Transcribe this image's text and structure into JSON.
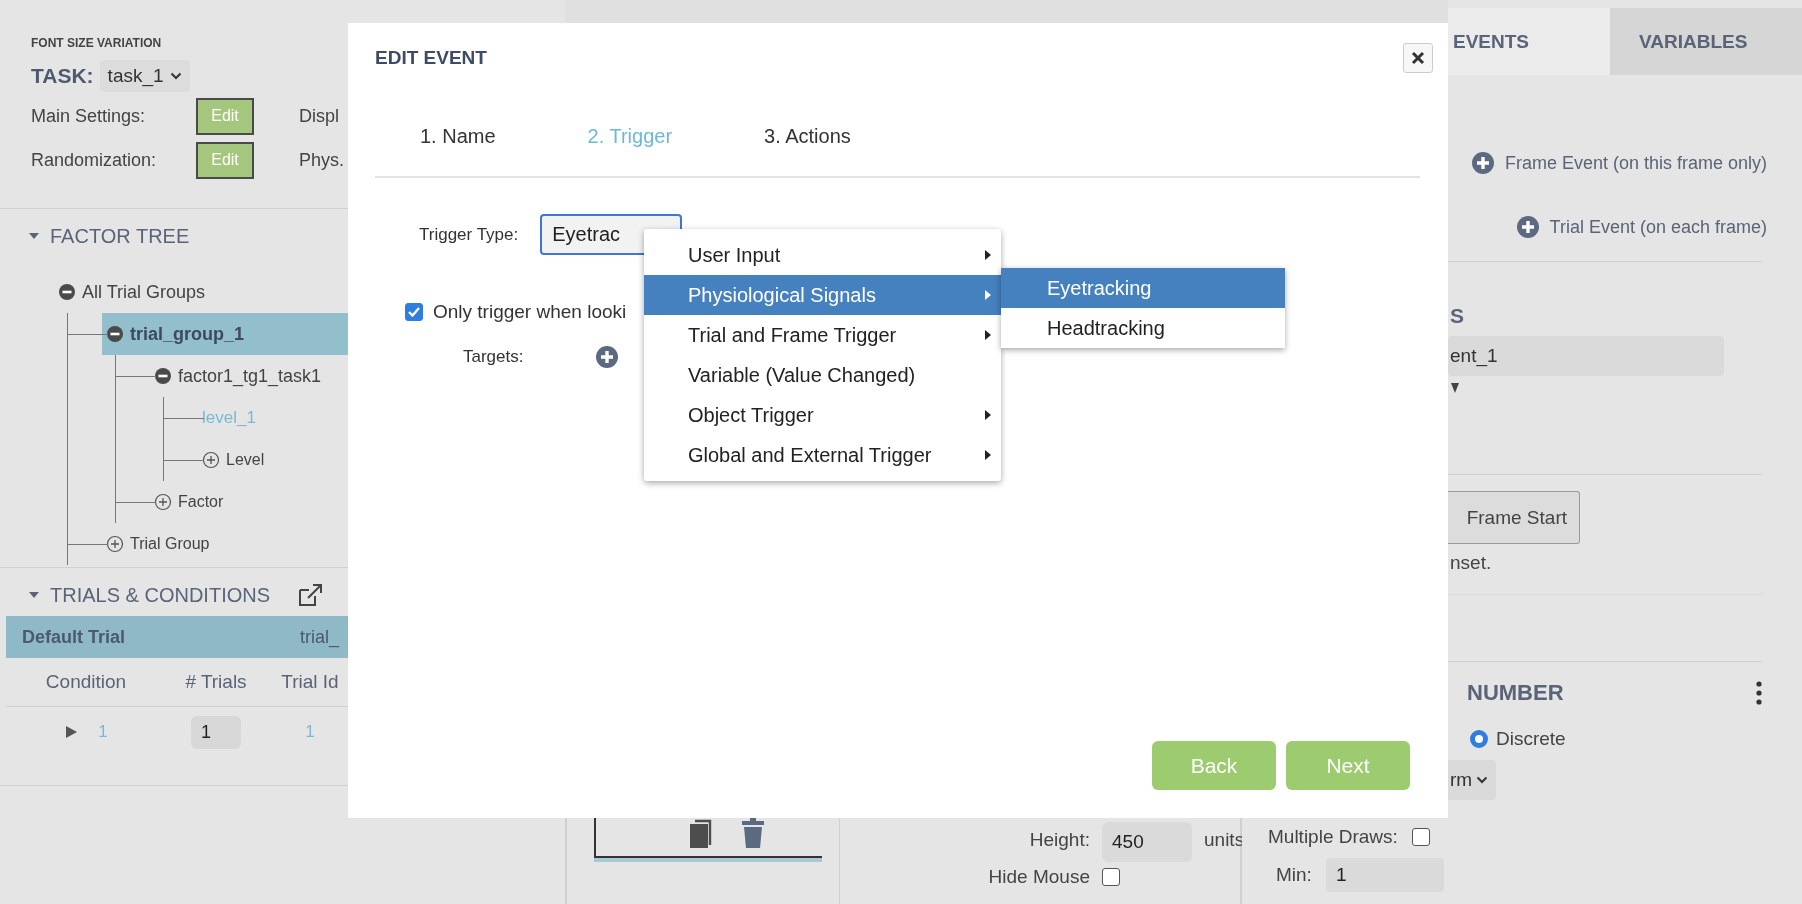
{
  "left_panel": {
    "project_title": "FONT SIZE VARIATION",
    "task_label": "TASK:",
    "task_select": {
      "value": "task_1"
    },
    "settings": [
      {
        "label": "Main Settings:",
        "button": "Edit",
        "side_label": "Displ"
      },
      {
        "label": "Randomization:",
        "button": "Edit",
        "side_label": "Phys."
      }
    ],
    "factor_tree": {
      "title": "FACTOR TREE",
      "expanded": true,
      "nodes": [
        {
          "label": "All Trial Groups",
          "kind": "node",
          "expanded": true,
          "selected": false,
          "children": [
            {
              "label": "trial_group_1",
              "kind": "node",
              "expanded": true,
              "selected": true,
              "children": [
                {
                  "label": "factor1_tg1_task1",
                  "kind": "node",
                  "expanded": true,
                  "selected": false,
                  "children": [
                    {
                      "label": "level_1",
                      "kind": "leaf",
                      "selected": false
                    },
                    {
                      "label": "Level",
                      "kind": "add",
                      "selected": false
                    }
                  ]
                },
                {
                  "label": "Factor",
                  "kind": "add",
                  "selected": false
                }
              ]
            },
            {
              "label": "Trial Group",
              "kind": "add",
              "selected": false
            }
          ]
        }
      ]
    },
    "trials": {
      "title": "TRIALS & CONDITIONS",
      "expanded": true,
      "trial": {
        "name": "Default Trial",
        "column_2": "trial_",
        "selected": true
      },
      "columns": [
        "Condition",
        "# Trials",
        "Trial Id"
      ],
      "rows": [
        {
          "condition": "1",
          "trials": "1",
          "trial_id": "1",
          "expanded": false
        }
      ]
    }
  },
  "dialog": {
    "title": "EDIT EVENT",
    "steps": [
      {
        "label": "1. Name",
        "selected": false
      },
      {
        "label": "2. Trigger",
        "selected": true
      },
      {
        "label": "3. Actions",
        "selected": false
      }
    ],
    "trigger_type": {
      "label": "Trigger Type:",
      "value": "Eyetrac"
    },
    "only_looking": {
      "label": "Only trigger when looki",
      "checked": true
    },
    "targets_label": "Targets:",
    "menu": [
      {
        "label": "User Input",
        "has_submenu": true,
        "selected": false
      },
      {
        "label": "Physiological Signals",
        "has_submenu": true,
        "selected": true
      },
      {
        "label": "Trial and Frame Trigger",
        "has_submenu": true,
        "selected": false
      },
      {
        "label": "Variable (Value Changed)",
        "has_submenu": false,
        "selected": false
      },
      {
        "label": "Object Trigger",
        "has_submenu": true,
        "selected": false
      },
      {
        "label": "Global and External Trigger",
        "has_submenu": true,
        "selected": false
      }
    ],
    "submenu": [
      {
        "label": "Eyetracking",
        "selected": true
      },
      {
        "label": "Headtracking",
        "selected": false
      }
    ],
    "buttons": [
      "Back",
      "Next"
    ]
  },
  "middle_bottom": {
    "height_label": "Height:",
    "height_value": "450",
    "height_unit": "units",
    "hide_mouse_label": "Hide Mouse",
    "hide_mouse": false
  },
  "right_panel": {
    "tabs": [
      {
        "label": "EVENTS",
        "selected": true
      },
      {
        "label": "VARIABLES",
        "selected": false
      }
    ],
    "add_events": [
      "Frame Event (on this frame only)",
      "Trial Event (on each frame)"
    ],
    "heading_1": "S",
    "name_field": "ent_1",
    "button": "Frame Start",
    "note": "nset.",
    "heading_2": "NUMBER",
    "radio": {
      "label": "Discrete",
      "selected": true
    },
    "select": "rm",
    "multiple_draws": {
      "label": "Multiple Draws:",
      "checked": false
    },
    "min": {
      "label": "Min:",
      "value": "1"
    }
  }
}
